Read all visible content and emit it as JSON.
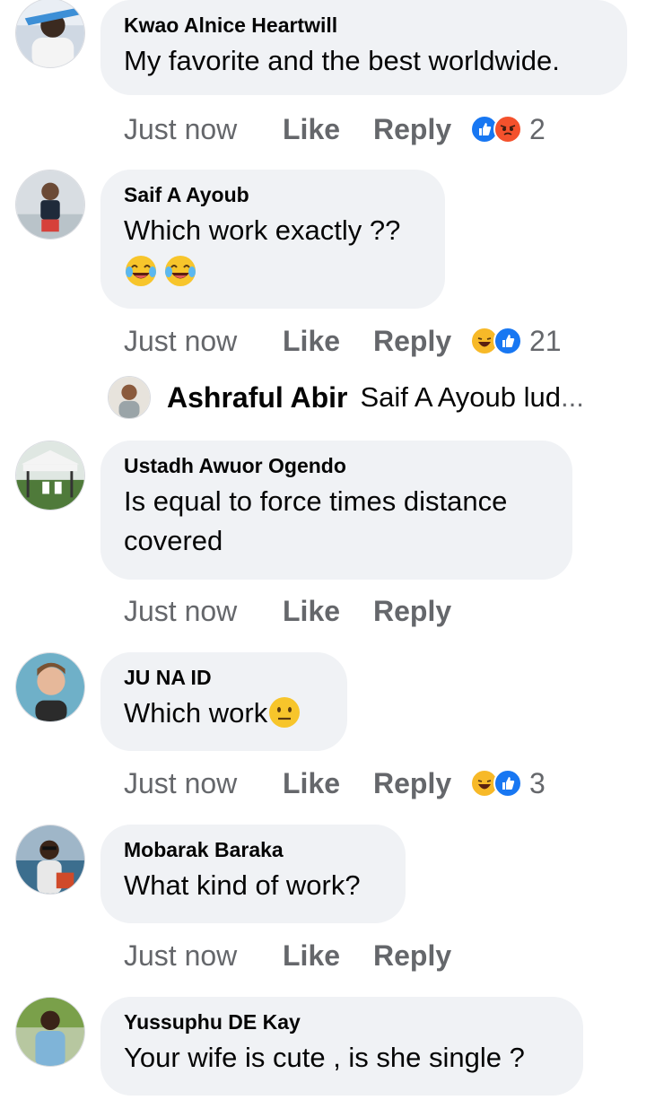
{
  "comments": [
    {
      "author": "Kwao Alnice Heartwill",
      "text": "My favorite and the best worldwide.",
      "time": "Just now",
      "like": "Like",
      "reply": "Reply",
      "reactions": [
        "like-reaction",
        "angry-reaction"
      ],
      "reaction_count": "2"
    },
    {
      "author": "Saif A Ayoub",
      "text": "Which work exactly ??",
      "emojis": [
        "tears-of-joy-emoji",
        "tears-of-joy-emoji"
      ],
      "time": "Just now",
      "like": "Like",
      "reply": "Reply",
      "reactions": [
        "haha-reaction",
        "like-reaction"
      ],
      "reaction_count": "21",
      "reply_preview": {
        "author": "Ashraful Abir",
        "text": "Saif A Ayoub lud",
        "ellipsis": "..."
      }
    },
    {
      "author": "Ustadh Awuor Ogendo",
      "text_line1": "Is equal to force times distance",
      "text_line2": "covered",
      "time": "Just now",
      "like": "Like",
      "reply": "Reply"
    },
    {
      "author": "JU NA ID",
      "text": "Which work",
      "emojis": [
        "neutral-face-emoji"
      ],
      "time": "Just now",
      "like": "Like",
      "reply": "Reply",
      "reactions": [
        "haha-reaction",
        "like-reaction"
      ],
      "reaction_count": "3"
    },
    {
      "author": "Mobarak Baraka",
      "text": "What kind of work?",
      "time": "Just now",
      "like": "Like",
      "reply": "Reply"
    },
    {
      "author": "Yussuphu DE Kay",
      "text": "Your wife is cute , is she single ?"
    }
  ],
  "colors": {
    "bubble": "#f0f2f5",
    "secondary_text": "#65676b",
    "like_blue": "#1877f2",
    "angry_orange": "#f4512c",
    "haha_yellow": "#f7b928"
  }
}
